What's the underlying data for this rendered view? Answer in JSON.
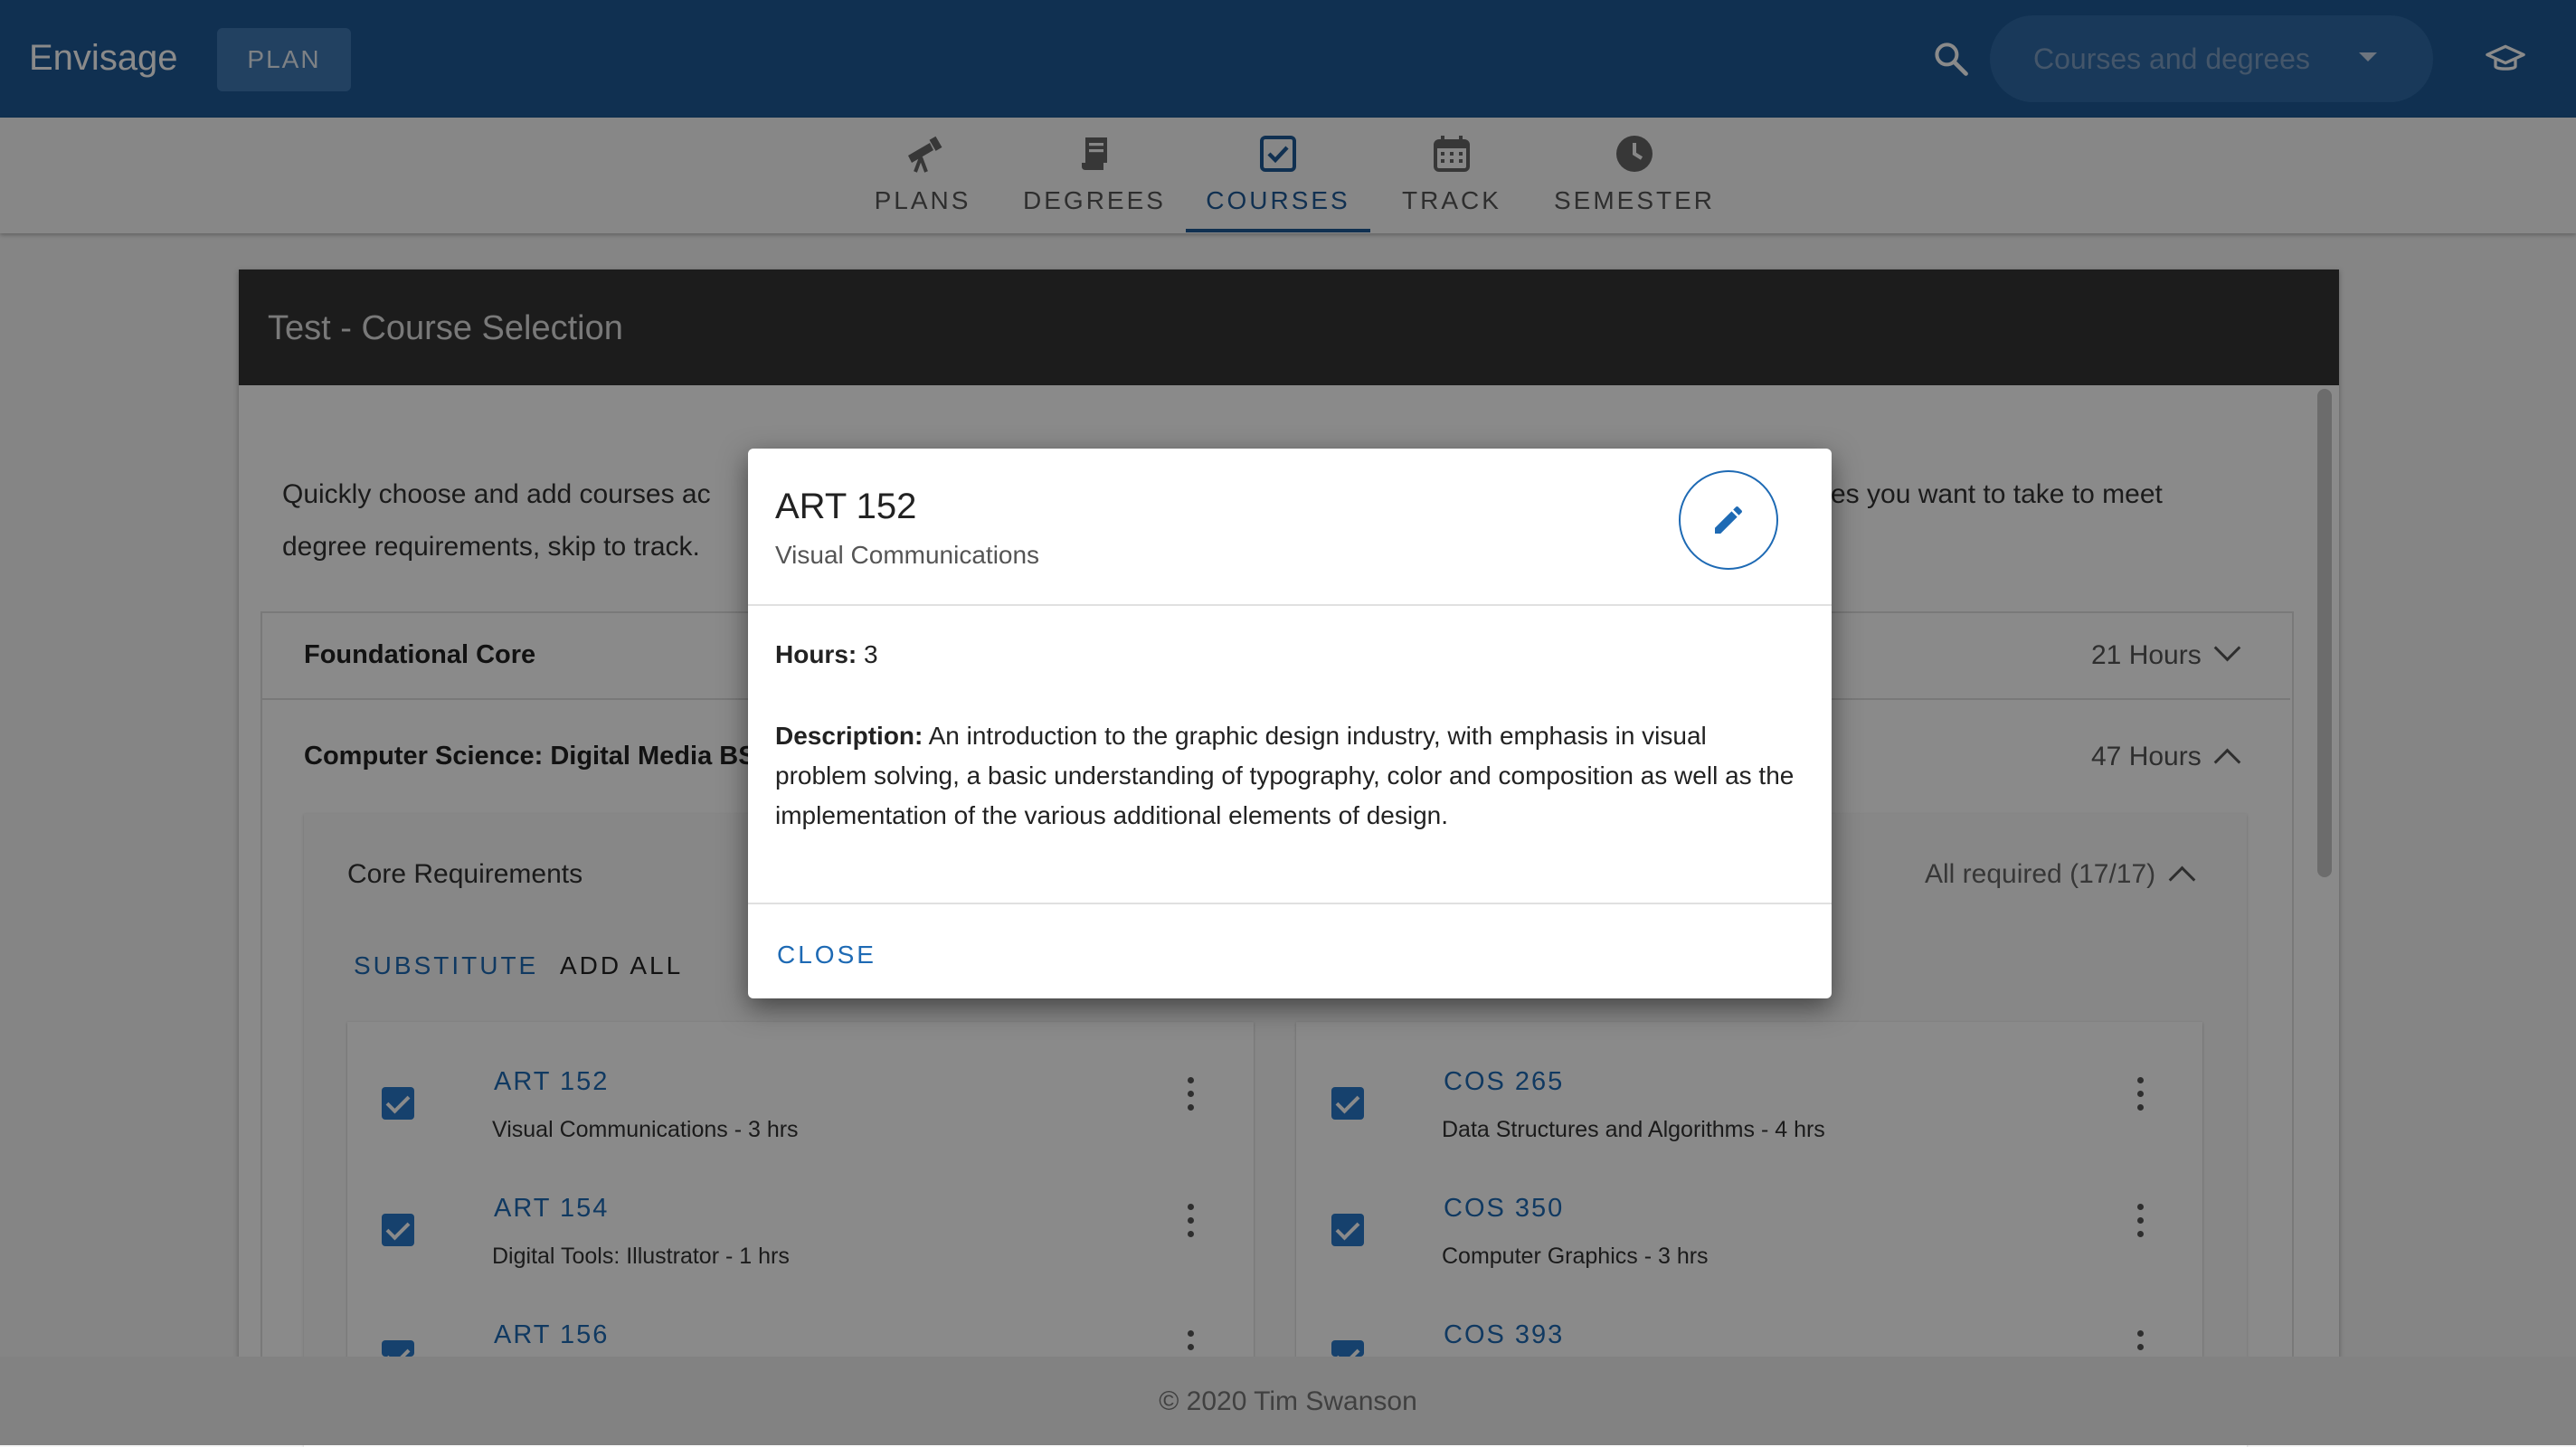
{
  "app": {
    "brand": "Envisage",
    "plan_button": "PLAN",
    "search_placeholder": "Courses and degrees"
  },
  "tabs": [
    {
      "label": "PLANS",
      "icon": "telescope-icon"
    },
    {
      "label": "DEGREES",
      "icon": "diploma-icon"
    },
    {
      "label": "COURSES",
      "icon": "checkbox-icon",
      "active": true
    },
    {
      "label": "TRACK",
      "icon": "calendar-icon"
    },
    {
      "label": "SEMESTER",
      "icon": "clock-icon"
    }
  ],
  "card": {
    "title": "Test - Course Selection",
    "intro_left": "Quickly choose and add courses ac",
    "intro_right": "es you want to take to meet",
    "intro_line2": "degree requirements, skip to track."
  },
  "sections": [
    {
      "title": "Foundational Core",
      "hours": "21 Hours"
    },
    {
      "title": "Computer Science: Digital Media BS",
      "hours": "47 Hours"
    }
  ],
  "core": {
    "title": "Core Requirements",
    "required": "All required (17/17)",
    "substitute": "SUBSTITUTE",
    "add_all": "ADD ALL"
  },
  "courses_left": [
    {
      "code": "ART 152",
      "desc": "Visual Communications - 3 hrs"
    },
    {
      "code": "ART 154",
      "desc": "Digital Tools: Illustrator - 1 hrs"
    },
    {
      "code": "ART 156",
      "desc": ""
    }
  ],
  "courses_right": [
    {
      "code": "COS 265",
      "desc": "Data Structures and Algorithms - 4 hrs"
    },
    {
      "code": "COS 350",
      "desc": "Computer Graphics - 3 hrs"
    },
    {
      "code": "COS 393",
      "desc": ""
    }
  ],
  "footer": "© 2020 Tim Swanson",
  "dialog": {
    "title": "ART 152",
    "subtitle": "Visual Communications",
    "hours_label": "Hours:",
    "hours_value": "3",
    "desc_label": "Description:",
    "desc_text": "An introduction to the graphic design industry, with emphasis in visual problem solving, a basic understanding of typography, color and composition as well as the implementation of the various additional elements of design.",
    "close": "CLOSE"
  },
  "colors": {
    "primary": "#1e5a96",
    "accent": "#1e6ab4",
    "checkbox": "#2979c9",
    "header_dark": "#353535"
  }
}
